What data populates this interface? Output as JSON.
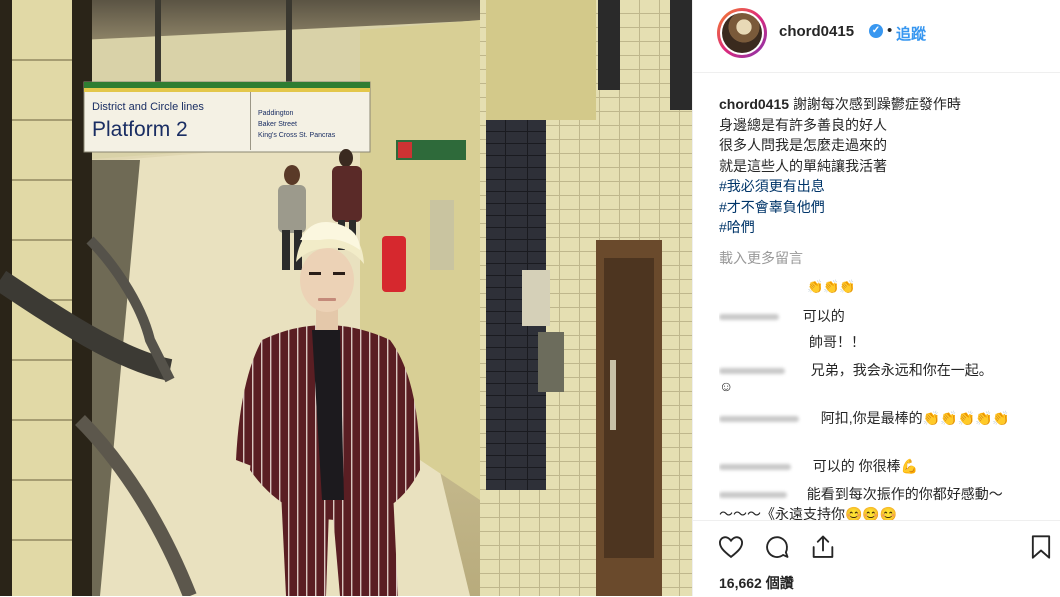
{
  "photo": {
    "sign_line": "District and Circle lines",
    "sign_title": "Platform 2",
    "sign_stops": [
      "Paddington",
      "Baker Street",
      "King's Cross St. Pancras"
    ]
  },
  "header": {
    "username": "chord0415",
    "verified_icon": "verified-badge-icon",
    "separator": "•",
    "follow_label": "追蹤"
  },
  "caption": {
    "username": "chord0415",
    "lines": [
      "謝謝每次感到躁鬱症發作時",
      "身邊總是有許多善良的好人",
      "很多人問我是怎麼走過來的",
      "就是這些人的單純讓我活著"
    ],
    "hashtags": [
      "#我必須更有出息",
      "#才不會辜負他們",
      "#哈們"
    ]
  },
  "load_more": "載入更多留言",
  "comments": [
    {
      "text": "👏👏👏"
    },
    {
      "text": "可以的"
    },
    {
      "text": "帥哥！！"
    },
    {
      "text": "兄弟，我会永远和你在一起。"
    },
    {
      "text": "☺"
    },
    {
      "text": "阿扣,你是最棒的👏👏👏👏👏"
    },
    {
      "text": "可以的 你很棒💪"
    },
    {
      "text": "能看到每次振作的你都好感動～"
    },
    {
      "text": "～～～《永遠支持你😊😊😊"
    }
  ],
  "actions": {
    "like_icon": "heart-icon",
    "comment_icon": "comment-icon",
    "share_icon": "share-icon",
    "save_icon": "bookmark-icon",
    "likes_text": "16,662 個讚"
  }
}
